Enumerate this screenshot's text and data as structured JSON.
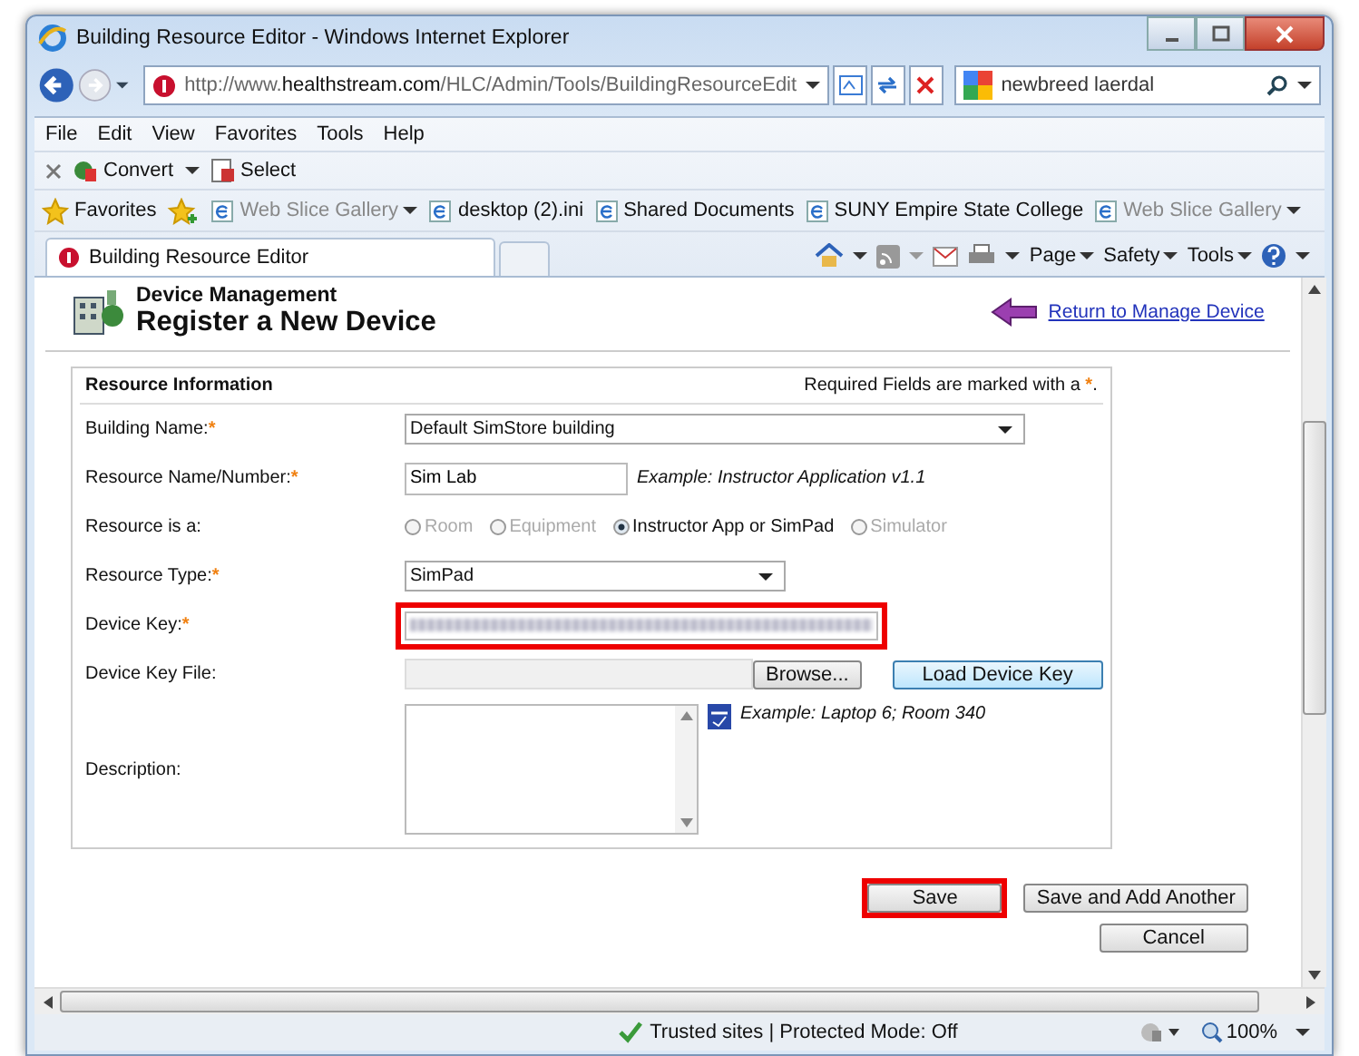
{
  "window": {
    "title": "Building Resource Editor - Windows Internet Explorer"
  },
  "address_bar": {
    "url_prefix": "http://www.",
    "url_domain": "healthstream.com",
    "url_path": "/HLC/Admin/Tools/BuildingResourceEdit",
    "search": "newbreed laerdal"
  },
  "menu": [
    "File",
    "Edit",
    "View",
    "Favorites",
    "Tools",
    "Help"
  ],
  "command_bar": [
    "Convert",
    "Select"
  ],
  "favorites_bar": [
    {
      "label": "Favorites",
      "disabled": false,
      "dropdown": false
    },
    {
      "label": "Web Slice Gallery",
      "disabled": true,
      "dropdown": true
    },
    {
      "label": "desktop (2).ini",
      "disabled": false,
      "dropdown": false
    },
    {
      "label": "Shared Documents",
      "disabled": false,
      "dropdown": false
    },
    {
      "label": "SUNY Empire State College",
      "disabled": false,
      "dropdown": false
    },
    {
      "label": "Web Slice Gallery",
      "disabled": true,
      "dropdown": true
    }
  ],
  "tabs": [
    {
      "label": "Building Resource Editor",
      "selected": true
    }
  ],
  "tab_tools": [
    "Page",
    "Safety",
    "Tools"
  ],
  "page": {
    "section": "Device Management",
    "heading": "Register a New Device",
    "return_link": "Return to Manage Device",
    "panel_title": "Resource Information",
    "required_note": "Required Fields are marked with a",
    "required_mark": "*",
    "required_end": ".",
    "fields": [
      {
        "kind": "select",
        "label": "Building Name:",
        "required_mark": "*",
        "value": "Default SimStore building",
        "wide": true
      },
      {
        "kind": "text",
        "label": "Resource Name/Number:",
        "required_mark": "*",
        "value": "Sim Lab",
        "hint": "Example: Instructor Application v1.1"
      },
      {
        "kind": "radio",
        "label": "Resource is a:",
        "options": [
          {
            "label": "Room",
            "selected": false,
            "disabled": true
          },
          {
            "label": "Equipment",
            "selected": false,
            "disabled": true
          },
          {
            "label": "Instructor App or SimPad",
            "selected": true,
            "disabled": false
          },
          {
            "label": "Simulator",
            "selected": false,
            "disabled": true
          }
        ]
      },
      {
        "kind": "select",
        "label": "Resource Type:",
        "required_mark": "*",
        "value": "SimPad",
        "wide": false
      },
      {
        "kind": "secret",
        "label": "Device Key:",
        "required_mark": "*",
        "highlighted": true
      },
      {
        "kind": "file",
        "label": "Device Key File:",
        "browse": "Browse...",
        "action": "Load Device Key"
      },
      {
        "kind": "textarea",
        "label": "Description:",
        "hint": "Example: Laptop 6; Room 340"
      }
    ],
    "buttons": [
      {
        "label": "Save",
        "highlighted": true
      },
      {
        "label": "Save and Add Another",
        "highlighted": false
      },
      {
        "label": "Cancel",
        "highlighted": false
      }
    ]
  },
  "status_bar": {
    "zone": "Trusted sites | Protected Mode: Off",
    "zoom": "100%"
  }
}
